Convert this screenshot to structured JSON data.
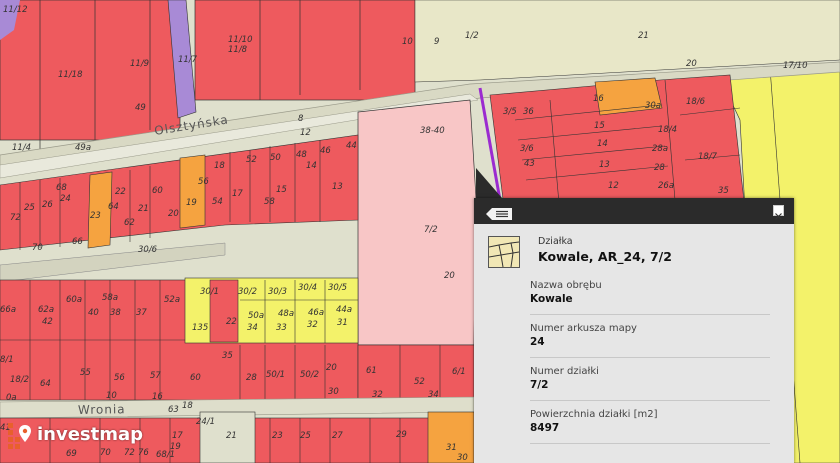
{
  "map": {
    "streets": [
      "Olsztyńska",
      "Wronia"
    ],
    "parcels": [
      "11/12",
      "11/8",
      "11/9",
      "11/10",
      "11/7",
      "11/18",
      "49",
      "11/4",
      "49a",
      "10",
      "9",
      "1/2",
      "21",
      "20",
      "17/10",
      "8",
      "12",
      "38-40",
      "7/2",
      "20",
      "3/5",
      "36",
      "16",
      "30a",
      "18/6",
      "3/6",
      "43",
      "15",
      "18/4",
      "14",
      "28a",
      "18/7",
      "13",
      "28",
      "12",
      "26a",
      "35",
      "44",
      "46",
      "48",
      "50",
      "52",
      "14",
      "13",
      "15",
      "17",
      "18",
      "56",
      "19",
      "54",
      "58",
      "60",
      "62",
      "64",
      "23",
      "66",
      "68",
      "70",
      "72",
      "25",
      "26",
      "24",
      "22",
      "21",
      "20",
      "30/6",
      "66a",
      "62a",
      "60a",
      "58a",
      "52a",
      "42",
      "40",
      "38",
      "37",
      "30/1",
      "30/2",
      "30/3",
      "30/4",
      "30/5",
      "135",
      "22",
      "50a",
      "48a",
      "46a",
      "44a",
      "34",
      "33",
      "32",
      "31",
      "8/1",
      "18/2",
      "0a",
      "64",
      "55",
      "56",
      "57",
      "60",
      "35",
      "28",
      "50/1",
      "50/2",
      "20",
      "61",
      "52",
      "6/1",
      "34",
      "32",
      "30",
      "41",
      "10",
      "16",
      "63",
      "18",
      "24/1",
      "21",
      "23",
      "25",
      "27",
      "29",
      "31",
      "30",
      "69",
      "70",
      "72",
      "76",
      "68/1",
      "19",
      "17"
    ]
  },
  "popup": {
    "type_label": "Działka",
    "title": "Kowale, AR_24, 7/2",
    "fields": [
      {
        "label": "Nazwa obrębu",
        "value": "Kowale"
      },
      {
        "label": "Numer arkusza mapy",
        "value": "24"
      },
      {
        "label": "Numer działki",
        "value": "7/2"
      },
      {
        "label": "Powierzchnia działki [m2]",
        "value": "8497"
      }
    ]
  },
  "colors": {
    "parcel_red": "#ee5a5e",
    "parcel_yellow": "#f3f26a",
    "parcel_orange": "#f5a340",
    "selected_pink": "#f8c6c6",
    "road": "#e2e2d0",
    "purple_strip": "#a88ad6"
  },
  "logo": {
    "text": "investmap"
  }
}
